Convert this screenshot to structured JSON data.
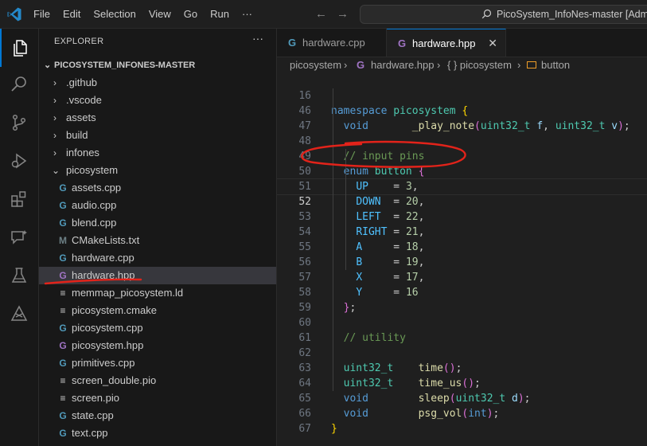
{
  "menu": [
    "File",
    "Edit",
    "Selection",
    "View",
    "Go",
    "Run",
    "···"
  ],
  "nav": {
    "back": "←",
    "forward": "→"
  },
  "search": {
    "text": "PicoSystem_InfoNes-master [Admini"
  },
  "sidebar": {
    "title": "EXPLORER",
    "more": "···",
    "root": "PICOSYSTEM_INFONES-MASTER",
    "folders": [
      {
        "label": ".github"
      },
      {
        "label": ".vscode"
      },
      {
        "label": "assets"
      },
      {
        "label": "build"
      },
      {
        "label": "infones"
      },
      {
        "label": "picosystem"
      }
    ],
    "files": [
      {
        "label": "assets.cpp"
      },
      {
        "label": "audio.cpp"
      },
      {
        "label": "blend.cpp"
      },
      {
        "label": "CMakeLists.txt"
      },
      {
        "label": "hardware.cpp"
      },
      {
        "label": "hardware.hpp"
      },
      {
        "label": "memmap_picosystem.ld"
      },
      {
        "label": "picosystem.cmake"
      },
      {
        "label": "picosystem.cpp"
      },
      {
        "label": "picosystem.hpp"
      },
      {
        "label": "primitives.cpp"
      },
      {
        "label": "screen_double.pio"
      },
      {
        "label": "screen.pio"
      },
      {
        "label": "state.cpp"
      },
      {
        "label": "text.cpp"
      }
    ]
  },
  "tabs": [
    {
      "label": "hardware.cpp",
      "icon": "G"
    },
    {
      "label": "hardware.hpp",
      "icon": "G",
      "close": "✕"
    }
  ],
  "breadcrumbs": {
    "folder": "picosystem",
    "file": "hardware.hpp",
    "namespace": "{ } picosystem",
    "symbol": "button"
  },
  "editor": {
    "line_numbers": [
      "16",
      "46",
      "47",
      "48",
      "49",
      "50",
      "51",
      "52",
      "53",
      "54",
      "55",
      "56",
      "57",
      "58",
      "59",
      "60",
      "61",
      "62",
      "63",
      "64",
      "65",
      "66",
      "67"
    ],
    "current_line": "52",
    "text": {
      "l16_kw": "namespace",
      "l16_name": "picosystem",
      "void": "void",
      "play_note": "_play_note",
      "uint32_t": "uint32_t",
      "p_f": "f",
      "p_v": "v",
      "input_comment": "// input pins",
      "enum_kw": "enum",
      "enum_name": "button",
      "e_UP": "UP",
      "e_DOWN": "DOWN",
      "e_LEFT": "LEFT",
      "e_RIGHT": "RIGHT",
      "e_A": "A",
      "e_B": "B",
      "e_X": "X",
      "e_Y": "Y",
      "v3": "3",
      "v20": "20",
      "v22": "22",
      "v21": "21",
      "v18": "18",
      "v19": "19",
      "v17": "17",
      "v16": "16",
      "utility_comment": "// utility",
      "time": "time",
      "time_us": "time_us",
      "sleep": "sleep",
      "p_d": "d",
      "psg_vol": "psg_vol",
      "int": "int"
    }
  },
  "colors": {
    "accent": "#0078d4",
    "annotation": "#e2231a"
  },
  "icons": [
    "explorer-icon",
    "search-icon",
    "source-control-icon",
    "run-debug-icon",
    "extensions-icon",
    "chat-icon",
    "testing-icon",
    "remote-icon"
  ]
}
